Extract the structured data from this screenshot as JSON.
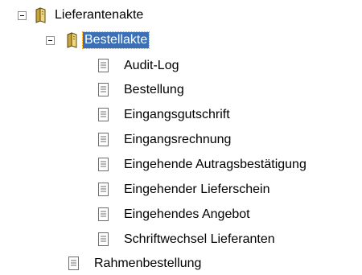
{
  "tree": {
    "root": {
      "label": "Lieferantenakte",
      "expanded": true,
      "icon": "book-folder-icon",
      "children": [
        {
          "label": "Bestellakte",
          "expanded": true,
          "selected": true,
          "icon": "book-folder-icon",
          "children": [
            {
              "label": "Audit-Log",
              "icon": "document-icon"
            },
            {
              "label": "Bestellung",
              "icon": "document-icon"
            },
            {
              "label": "Eingangsgutschrift",
              "icon": "document-icon"
            },
            {
              "label": "Eingangsrechnung",
              "icon": "document-icon"
            },
            {
              "label": "Eingehende Autragsbestätigung",
              "icon": "document-icon"
            },
            {
              "label": "Eingehender Lieferschein",
              "icon": "document-icon"
            },
            {
              "label": "Eingehendes Angebot",
              "icon": "document-icon"
            },
            {
              "label": "Schriftwechsel Lieferanten",
              "icon": "document-icon"
            }
          ]
        },
        {
          "label": "Rahmenbestellung",
          "icon": "document-icon"
        }
      ]
    }
  },
  "colors": {
    "selection_background": "#3b6fb6",
    "selection_text": "#ffffff",
    "focus_outline": "#ff9b00",
    "folder_fill": "#e8c85a"
  }
}
